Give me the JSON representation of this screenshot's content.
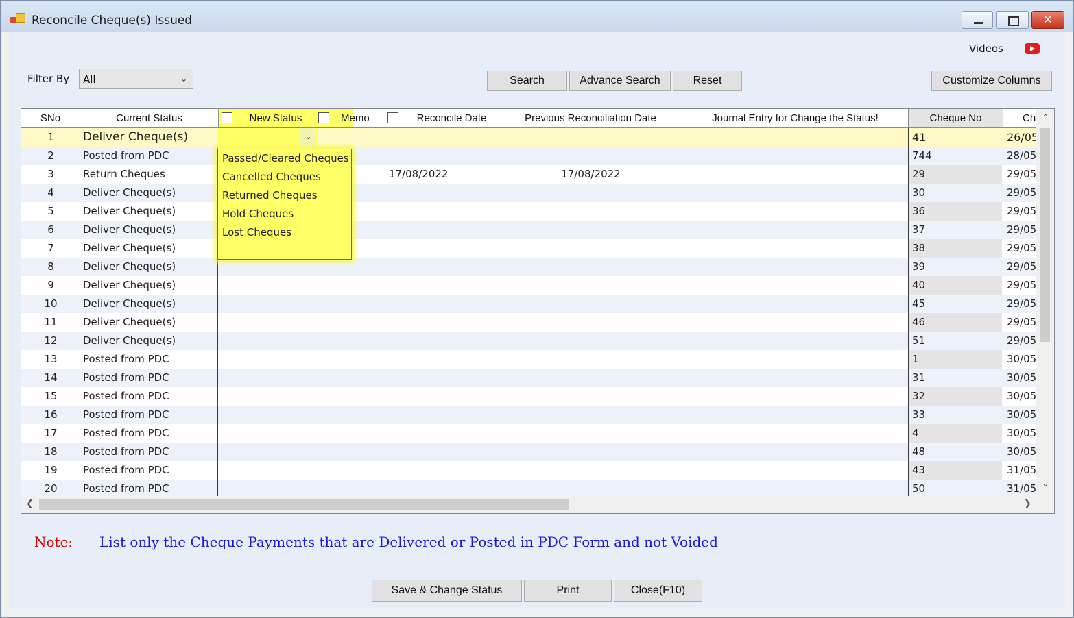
{
  "window": {
    "title": "Reconcile Cheque(s) Issued",
    "minimize_glyph": "",
    "close_glyph": "✕",
    "icons": [
      "app-icon",
      "minimize-icon",
      "maximize-icon",
      "close-icon"
    ]
  },
  "top": {
    "videos_label": "Videos",
    "video_icon": "youtube-play-icon"
  },
  "filter": {
    "label": "Filter By",
    "value": "All"
  },
  "buttons": {
    "search": "Search",
    "advance_search": "Advance Search",
    "reset": "Reset",
    "customize_columns": "Customize Columns",
    "save_change_status": "Save & Change Status",
    "print": "Print",
    "close": "Close(F10)"
  },
  "grid": {
    "columns": {
      "sno": "SNo",
      "current_status": "Current Status",
      "new_status": "New Status",
      "memo": "Memo",
      "reconcile_date": "Reconcile Date",
      "previous_reconciliation_date": "Previous Reconciliation Date",
      "journal_entry": "Journal Entry for Change the Status!",
      "cheque_no": "Cheque No",
      "cheque_date": "Ch"
    },
    "rows": [
      {
        "sno": "1",
        "current_status": "Deliver Cheque(s)",
        "reconcile_date": "",
        "previous_reconciliation_date": "",
        "cheque_no": "41",
        "cheque_date": "26/05"
      },
      {
        "sno": "2",
        "current_status": "Posted from PDC",
        "reconcile_date": "",
        "previous_reconciliation_date": "",
        "cheque_no": "744",
        "cheque_date": "28/05,"
      },
      {
        "sno": "3",
        "current_status": "Return Cheques",
        "reconcile_date": "17/08/2022",
        "previous_reconciliation_date": "17/08/2022",
        "cheque_no": "29",
        "cheque_date": "29/05,"
      },
      {
        "sno": "4",
        "current_status": "Deliver Cheque(s)",
        "reconcile_date": "",
        "previous_reconciliation_date": "",
        "cheque_no": "30",
        "cheque_date": "29/05,"
      },
      {
        "sno": "5",
        "current_status": "Deliver Cheque(s)",
        "reconcile_date": "",
        "previous_reconciliation_date": "",
        "cheque_no": "36",
        "cheque_date": "29/05,"
      },
      {
        "sno": "6",
        "current_status": "Deliver Cheque(s)",
        "reconcile_date": "",
        "previous_reconciliation_date": "",
        "cheque_no": "37",
        "cheque_date": "29/05,"
      },
      {
        "sno": "7",
        "current_status": "Deliver Cheque(s)",
        "reconcile_date": "",
        "previous_reconciliation_date": "",
        "cheque_no": "38",
        "cheque_date": "29/05,"
      },
      {
        "sno": "8",
        "current_status": "Deliver Cheque(s)",
        "reconcile_date": "",
        "previous_reconciliation_date": "",
        "cheque_no": "39",
        "cheque_date": "29/05,"
      },
      {
        "sno": "9",
        "current_status": "Deliver Cheque(s)",
        "reconcile_date": "",
        "previous_reconciliation_date": "",
        "cheque_no": "40",
        "cheque_date": "29/05,"
      },
      {
        "sno": "10",
        "current_status": "Deliver Cheque(s)",
        "reconcile_date": "",
        "previous_reconciliation_date": "",
        "cheque_no": "45",
        "cheque_date": "29/05,"
      },
      {
        "sno": "11",
        "current_status": "Deliver Cheque(s)",
        "reconcile_date": "",
        "previous_reconciliation_date": "",
        "cheque_no": "46",
        "cheque_date": "29/05,"
      },
      {
        "sno": "12",
        "current_status": "Deliver Cheque(s)",
        "reconcile_date": "",
        "previous_reconciliation_date": "",
        "cheque_no": "51",
        "cheque_date": "29/05,"
      },
      {
        "sno": "13",
        "current_status": "Posted from PDC",
        "reconcile_date": "",
        "previous_reconciliation_date": "",
        "cheque_no": "1",
        "cheque_date": "30/05,"
      },
      {
        "sno": "14",
        "current_status": "Posted from PDC",
        "reconcile_date": "",
        "previous_reconciliation_date": "",
        "cheque_no": "31",
        "cheque_date": "30/05,"
      },
      {
        "sno": "15",
        "current_status": "Posted from PDC",
        "reconcile_date": "",
        "previous_reconciliation_date": "",
        "cheque_no": "32",
        "cheque_date": "30/05,"
      },
      {
        "sno": "16",
        "current_status": "Posted from PDC",
        "reconcile_date": "",
        "previous_reconciliation_date": "",
        "cheque_no": "33",
        "cheque_date": "30/05,"
      },
      {
        "sno": "17",
        "current_status": "Posted from PDC",
        "reconcile_date": "",
        "previous_reconciliation_date": "",
        "cheque_no": "4",
        "cheque_date": "30/05,"
      },
      {
        "sno": "18",
        "current_status": "Posted from PDC",
        "reconcile_date": "",
        "previous_reconciliation_date": "",
        "cheque_no": "48",
        "cheque_date": "30/05,"
      },
      {
        "sno": "19",
        "current_status": "Posted from PDC",
        "reconcile_date": "",
        "previous_reconciliation_date": "",
        "cheque_no": "43",
        "cheque_date": "31/05,"
      },
      {
        "sno": "20",
        "current_status": "Posted from PDC",
        "reconcile_date": "",
        "previous_reconciliation_date": "",
        "cheque_no": "50",
        "cheque_date": "31/05,"
      }
    ]
  },
  "new_status_dropdown": {
    "options": [
      "Passed/Cleared Cheques",
      "Cancelled Cheques",
      "Returned Cheques",
      "Hold Cheques",
      "Lost Cheques"
    ]
  },
  "note": {
    "label": "Note:",
    "text": "List only the Cheque Payments that are Delivered or Posted in PDC Form and not Voided"
  },
  "colors": {
    "highlight": "#ffff66",
    "selected_row": "#fff9c6",
    "note_label": "#e00000",
    "note_text": "#1a1adf"
  }
}
